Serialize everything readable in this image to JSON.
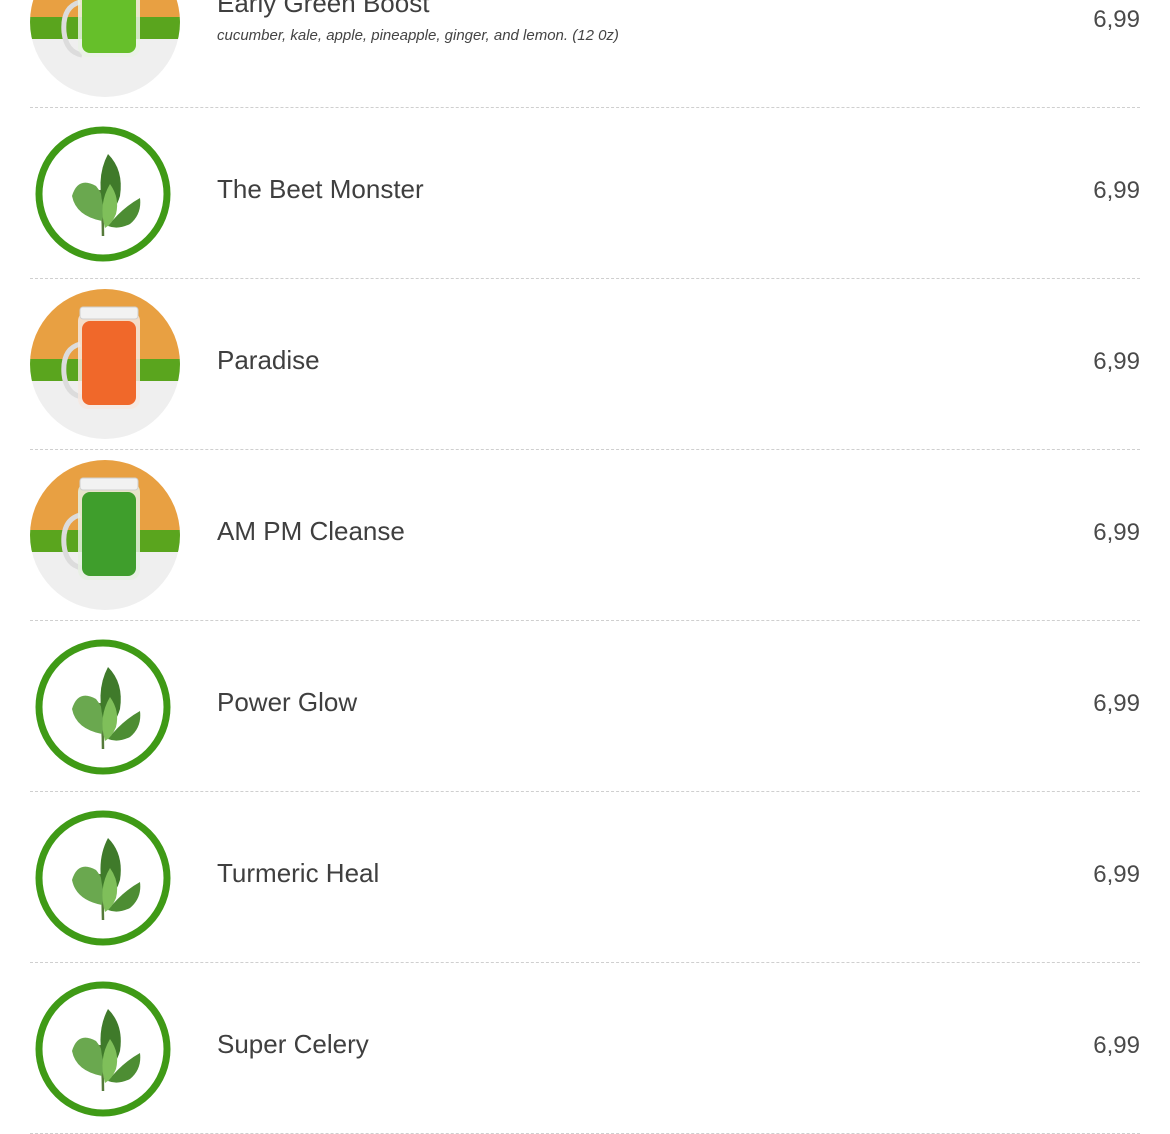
{
  "menu": {
    "items": [
      {
        "name": "Early Green Boost",
        "description": "cucumber, kale, apple, pineapple, ginger, and lemon. (12 0z)",
        "price": "6,99",
        "image": "green-juice-photo",
        "juice_color": "#5fbf2a"
      },
      {
        "name": "The Beet Monster",
        "description": "",
        "price": "6,99",
        "image": "leaf-placeholder-icon"
      },
      {
        "name": "Paradise",
        "description": "",
        "price": "6,99",
        "image": "orange-juice-photo",
        "juice_color": "#f0682a"
      },
      {
        "name": "AM PM Cleanse",
        "description": "",
        "price": "6,99",
        "image": "green-juice-photo",
        "juice_color": "#3f9e2c"
      },
      {
        "name": "Power Glow",
        "description": "",
        "price": "6,99",
        "image": "leaf-placeholder-icon"
      },
      {
        "name": "Turmeric Heal",
        "description": "",
        "price": "6,99",
        "image": "leaf-placeholder-icon"
      },
      {
        "name": "Super Celery",
        "description": "",
        "price": "6,99",
        "image": "leaf-placeholder-icon"
      }
    ]
  },
  "colors": {
    "brand_green": "#3f9a16",
    "leaf_dark": "#3f7a2a",
    "leaf_light": "#6aa84f",
    "divider": "#cfcfcf"
  }
}
